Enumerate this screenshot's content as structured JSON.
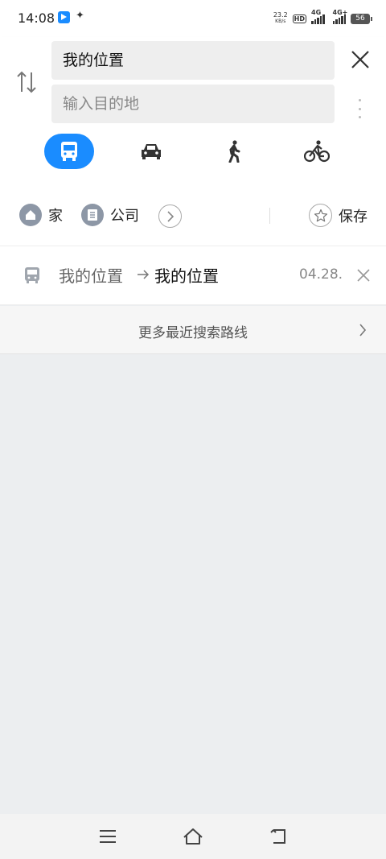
{
  "status_bar": {
    "time": "14:08",
    "net_speed_value": "23.2",
    "net_speed_unit": "KB/s",
    "hd_label": "HD",
    "sim1_label": "4G",
    "sim2_label": "4G+",
    "battery": "56"
  },
  "search": {
    "from_value": "我的位置",
    "to_placeholder": "输入目的地"
  },
  "modes": [
    {
      "name": "bus",
      "icon": "bus-icon",
      "active": true
    },
    {
      "name": "car",
      "icon": "car-icon",
      "active": false
    },
    {
      "name": "walk",
      "icon": "walk-icon",
      "active": false
    },
    {
      "name": "bike",
      "icon": "bike-icon",
      "active": false
    }
  ],
  "quick_places": {
    "home_label": "家",
    "company_label": "公司",
    "save_label": "保存"
  },
  "history": [
    {
      "from": "我的位置",
      "to": "我的位置",
      "date": "04.28."
    }
  ],
  "more_history_label": "更多最近搜索路线",
  "colors": {
    "accent": "#1a8cff",
    "place_icon_bg": "#8d97a6",
    "page_bg": "#eceef0"
  }
}
